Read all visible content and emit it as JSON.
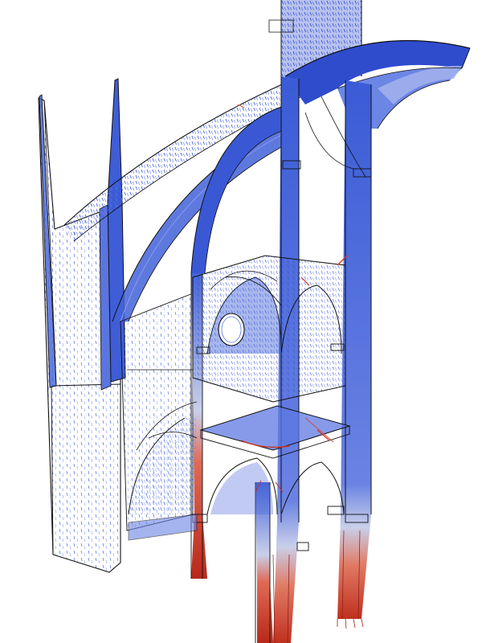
{
  "figure": {
    "subject": "gothic-cathedral-cross-section",
    "visualization": "stress-vector-field",
    "text": []
  },
  "colors": {
    "background": "#ffffff",
    "edge": "#111111",
    "low_stress": "#3a5bd6",
    "low_stress_light": "#7d93ea",
    "mid_stress": "#c9cfea",
    "high_stress": "#d43a2a",
    "high_stress_dark": "#a41f17"
  }
}
